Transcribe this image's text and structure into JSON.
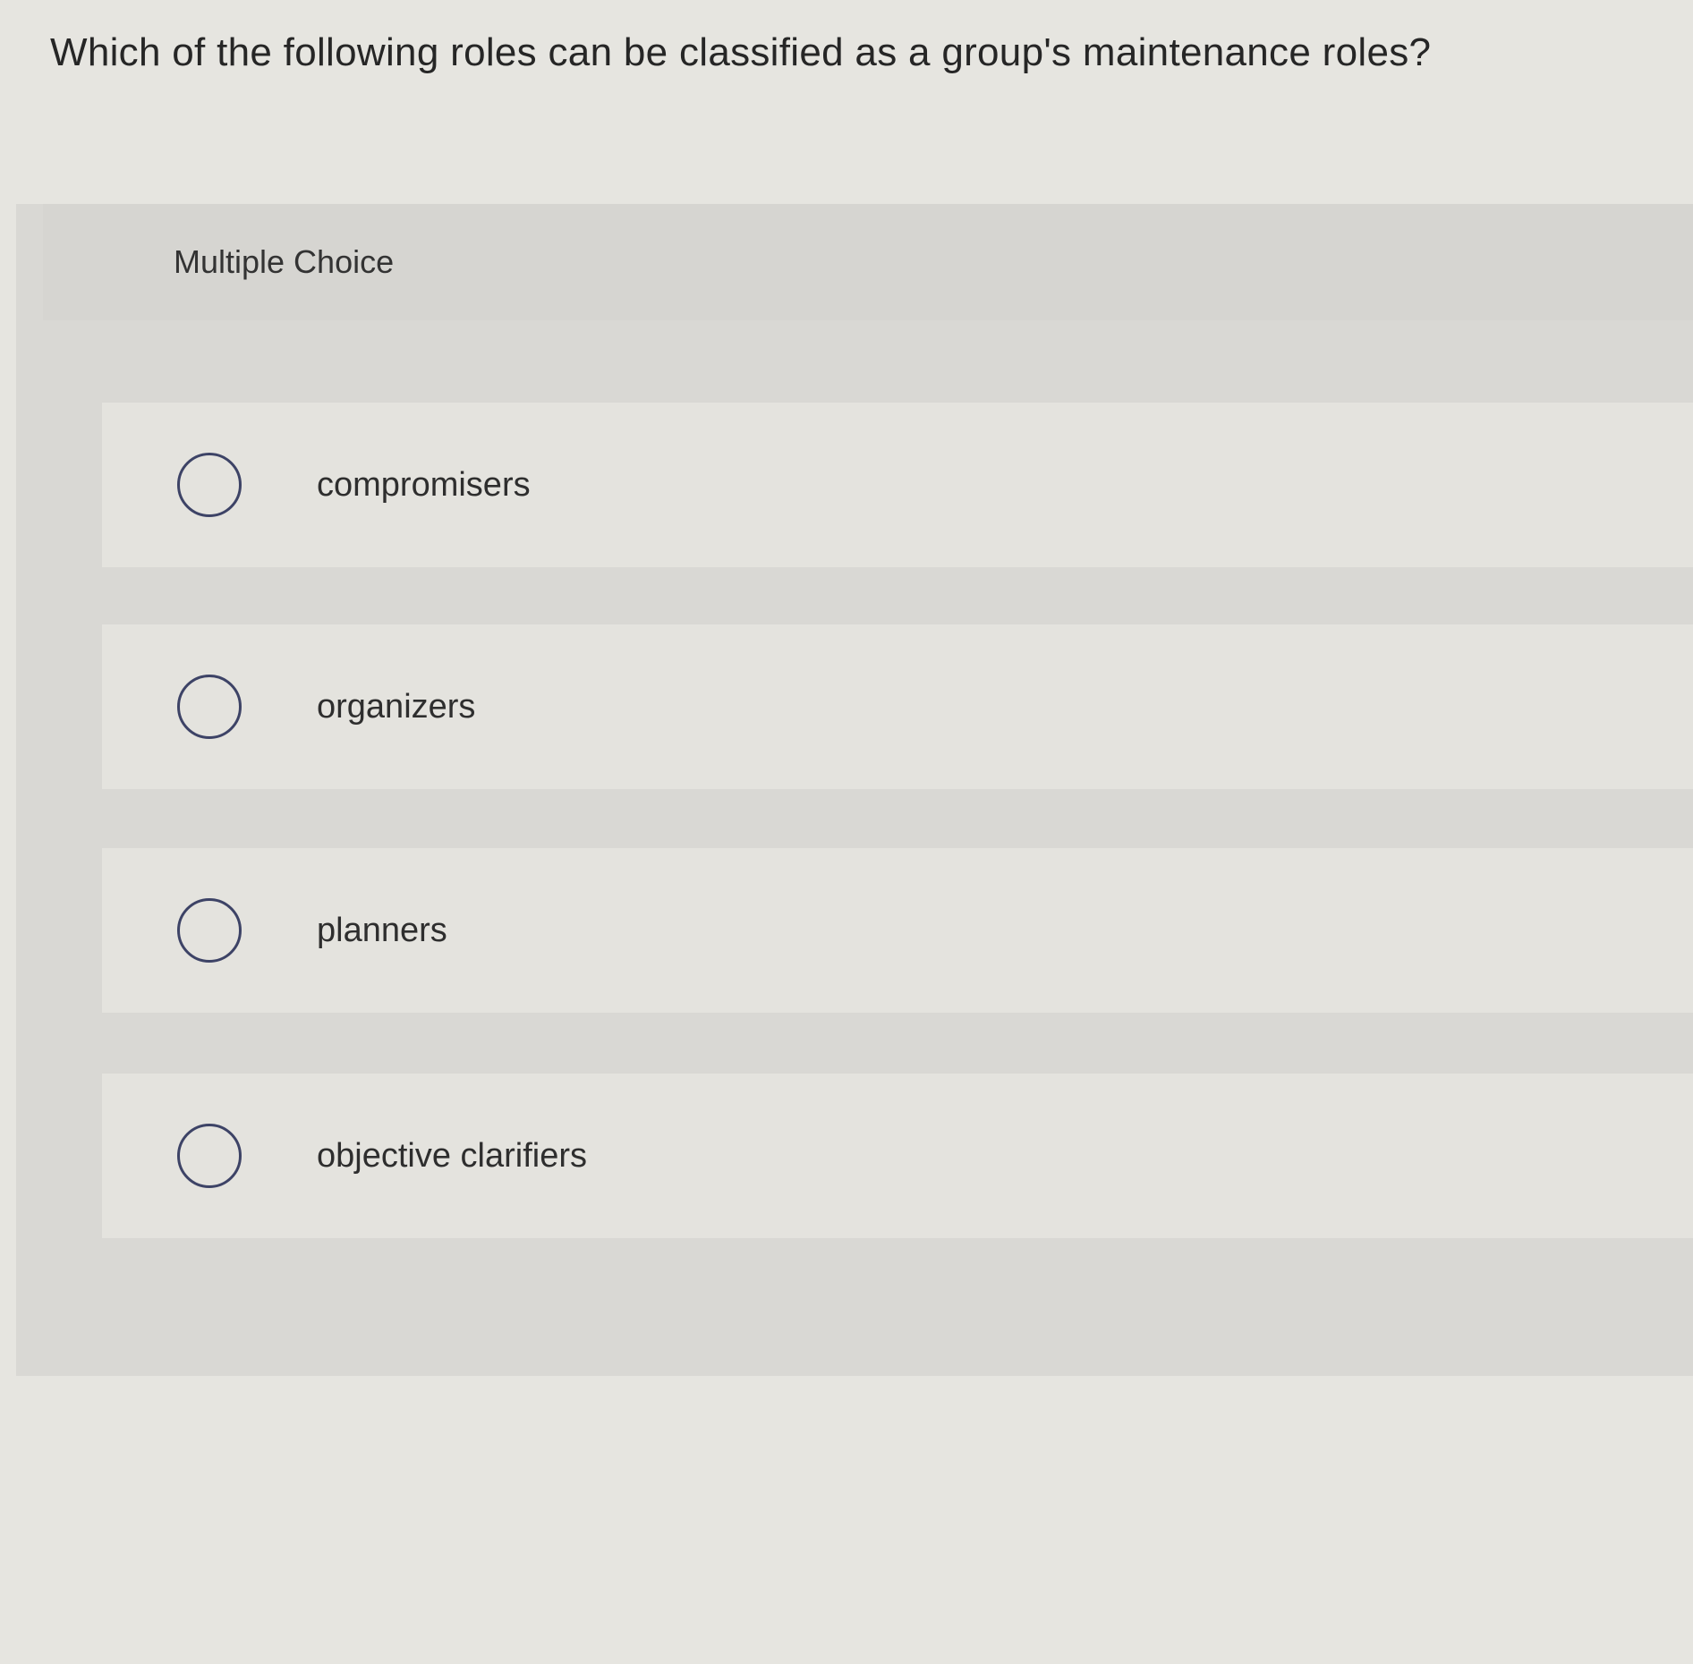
{
  "question": {
    "text": "Which of the following roles can be classified as a group's maintenance roles?"
  },
  "panel": {
    "label": "Multiple Choice"
  },
  "options": [
    {
      "label": "compromisers"
    },
    {
      "label": "organizers"
    },
    {
      "label": "planners"
    },
    {
      "label": "objective clarifiers"
    }
  ]
}
